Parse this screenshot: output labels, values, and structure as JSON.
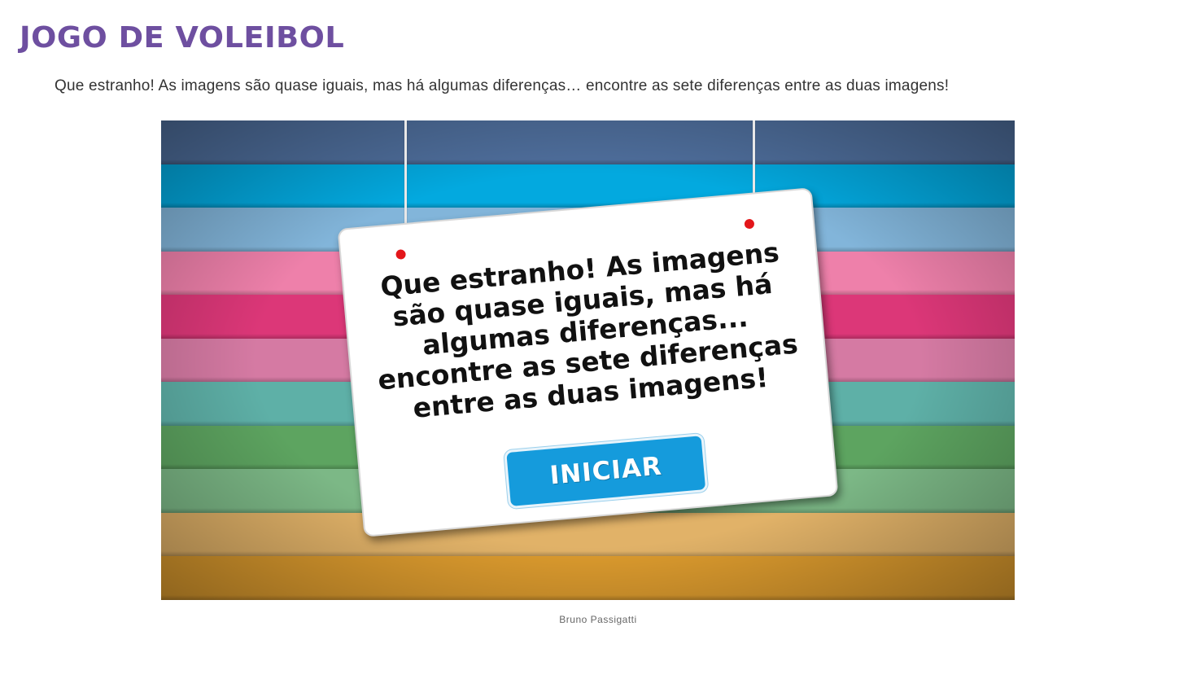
{
  "page": {
    "title": "JOGO DE VOLEIBOL",
    "intro": "Que estranho! As imagens são quase iguais, mas há algumas diferenças… encontre as sete diferenças entre as duas imagens!",
    "credit": "Bruno Passigatti"
  },
  "game": {
    "board_text": "Que estranho! As imagens são quase iguais, mas há algumas diferenças... encontre as sete diferenças entre as duas imagens!",
    "start_label": "INICIAR",
    "stripe_colors": [
      "#4f6f9d",
      "#03a9df",
      "#82b5da",
      "#ee80aa",
      "#dc3778",
      "#d57aa3",
      "#5eb0a7",
      "#5da460",
      "#7cb886",
      "#e1b268",
      "#dc9b2e"
    ],
    "hole_color": "#e3161a",
    "button_color": "#159bdc"
  },
  "colors": {
    "title": "#6e4fa0"
  }
}
